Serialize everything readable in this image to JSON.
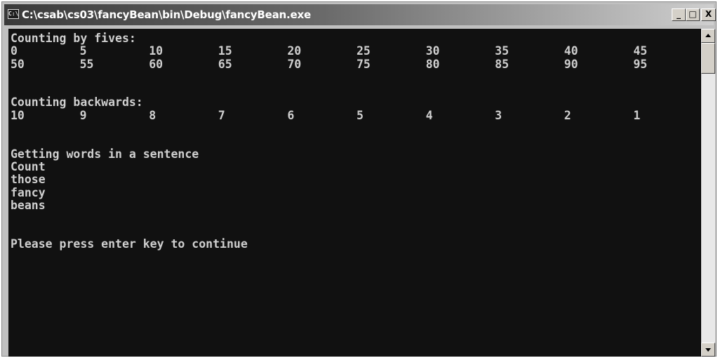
{
  "window": {
    "title": "C:\\csab\\cs03\\fancyBean\\bin\\Debug\\fancyBean.exe",
    "icon": "console-app-icon",
    "icon_glyph": "C:\\",
    "minimize_glyph": "_",
    "maximize_glyph": "□",
    "close_glyph": "X"
  },
  "console": {
    "lines": [
      "Counting by fives:",
      [
        "0",
        "5",
        "10",
        "15",
        "20",
        "25",
        "30",
        "35",
        "40",
        "45"
      ],
      [
        "50",
        "55",
        "60",
        "65",
        "70",
        "75",
        "80",
        "85",
        "90",
        "95"
      ],
      "",
      "",
      "Counting backwards:",
      [
        "10",
        "9",
        "8",
        "7",
        "6",
        "5",
        "4",
        "3",
        "2",
        "1"
      ],
      "",
      "",
      "Getting words in a sentence",
      "Count",
      "those",
      "fancy",
      "beans",
      "",
      "",
      "Please press enter key to continue"
    ]
  },
  "colors": {
    "console_bg": "#111111",
    "console_fg": "#cfcfcf",
    "titlebar_start": "#3a3a3a",
    "titlebar_end": "#cfcfcf"
  },
  "icons": {
    "scroll_up": "scroll-up-arrow-icon",
    "scroll_down": "scroll-down-arrow-icon"
  }
}
